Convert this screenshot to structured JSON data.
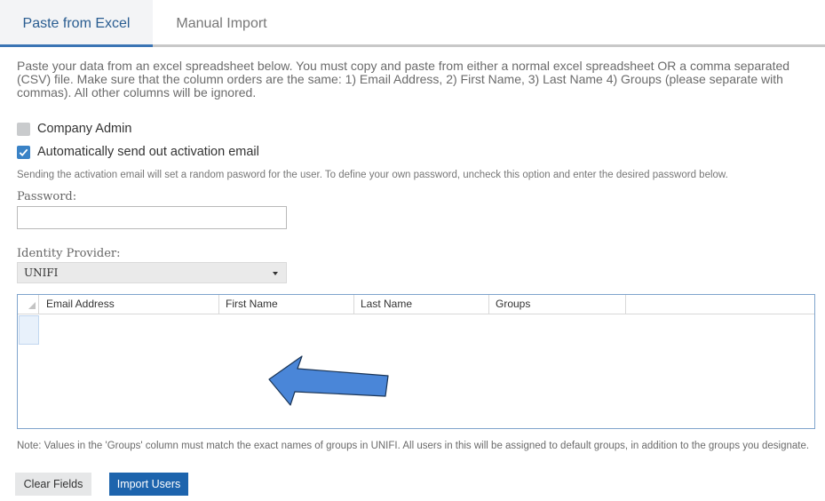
{
  "tabs": [
    {
      "label": "Paste from Excel",
      "active": true
    },
    {
      "label": "Manual Import",
      "active": false
    }
  ],
  "description": "Paste your data from an excel spreadsheet below. You must copy and paste from either a normal excel spreadsheet OR a comma separated (CSV) file. Make sure that the column orders are the same: 1) Email Address, 2) First Name, 3) Last Name 4) Groups (please separate with commas). All other columns will be ignored.",
  "options": {
    "company_admin": {
      "label": "Company Admin",
      "checked": false
    },
    "send_activation": {
      "label": "Automatically send out activation email",
      "checked": true
    }
  },
  "activation_note": "Sending the activation email will set a random pasword for the user. To define your own password, uncheck this option and enter the desired password below.",
  "password": {
    "label": "Password:",
    "value": ""
  },
  "identity_provider": {
    "label": "Identity Provider:",
    "selected": "UNIFI"
  },
  "grid": {
    "columns": [
      "Email Address",
      "First Name",
      "Last Name",
      "Groups"
    ],
    "rows": []
  },
  "annotation": {
    "type": "arrow",
    "color": "#4a86d8"
  },
  "footnote": "Note: Values in the 'Groups' column must match the exact names of groups in UNIFI. All users in this will be assigned to default groups, in addition to the groups you designate.",
  "buttons": {
    "clear": "Clear Fields",
    "import": "Import Users"
  },
  "colors": {
    "accent": "#3a74b4",
    "primary_button": "#1d64ad",
    "checkbox_on": "#3a82c6"
  }
}
